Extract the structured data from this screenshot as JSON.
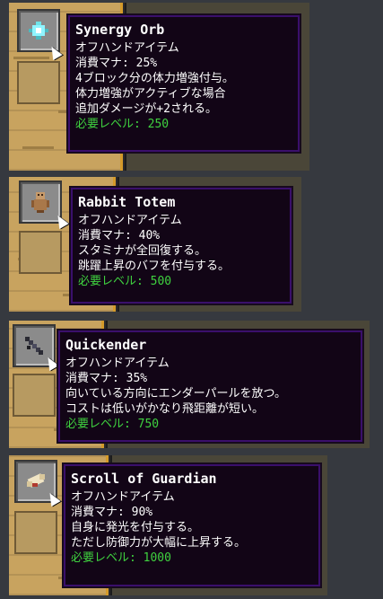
{
  "colors": {
    "tooltip_bg": "#120516",
    "tooltip_border": "#3a0f6b",
    "requirement_text": "#3fd23f",
    "text": "#ffffff"
  },
  "items": [
    {
      "icon": "orb-icon",
      "name": "Synergy Orb",
      "lines": [
        "オフハンドアイテム",
        "消費マナ: 25%",
        "4ブロック分の体力増強付与。",
        "体力増強がアクティブな場合",
        "追加ダメージが+2される。"
      ],
      "requirement": "必要レベル: 250"
    },
    {
      "icon": "totem-icon",
      "name": "Rabbit Totem",
      "lines": [
        "オフハンドアイテム",
        "消費マナ: 40%",
        "スタミナが全回復する。",
        "跳躍上昇のバフを付与する。"
      ],
      "requirement": "必要レベル: 500"
    },
    {
      "icon": "ender-launcher-icon",
      "name": "Quickender",
      "lines": [
        "オフハンドアイテム",
        "消費マナ: 35%",
        "向いている方向にエンダーパールを放つ。",
        "コストは低いがかなり飛距離が短い。"
      ],
      "requirement": "必要レベル: 750"
    },
    {
      "icon": "scroll-icon",
      "name": "Scroll of Guardian",
      "lines": [
        "オフハンドアイテム",
        "消費マナ: 90%",
        "自身に発光を付与する。",
        "ただし防御力が大幅に上昇する。"
      ],
      "requirement": "必要レベル: 1000"
    }
  ]
}
